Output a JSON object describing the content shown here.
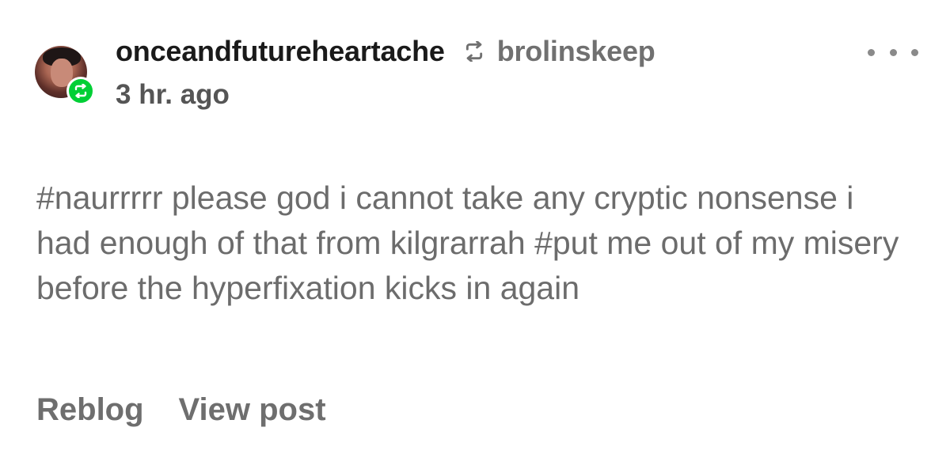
{
  "post": {
    "author": "onceandfutureheartache",
    "reblogged_from": "brolinskeep",
    "timestamp": "3 hr. ago",
    "avatar_icon": "user-avatar-icon",
    "badge_icon": "reblog-icon",
    "more_icon": "ellipsis-icon",
    "tags": [
      "#naurrrrr please god i cannot take any cryptic nonsense i had enough of that from kilgrarrah",
      "#put me out of my misery before the hyperfixation kicks in again"
    ],
    "actions": {
      "reblog_label": "Reblog",
      "view_post_label": "View post"
    }
  },
  "colors": {
    "background": "#ffffff",
    "author_text": "#1a1a1a",
    "secondary_text": "#6e6e6e",
    "reblog_badge": "#00cf35"
  }
}
